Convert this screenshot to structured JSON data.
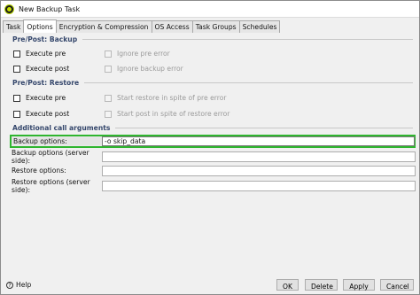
{
  "window": {
    "title": "New Backup Task"
  },
  "tabs": [
    {
      "label": "Task"
    },
    {
      "label": "Options"
    },
    {
      "label": "Encryption & Compression"
    },
    {
      "label": "OS Access"
    },
    {
      "label": "Task Groups"
    },
    {
      "label": "Schedules"
    }
  ],
  "active_tab": "Options",
  "pre_post_backup": {
    "header": "Pre/Post: Backup",
    "execute_pre": {
      "label": "Execute pre",
      "checked": false
    },
    "execute_post": {
      "label": "Execute post",
      "checked": false
    },
    "ignore_pre_error": {
      "label": "Ignore pre error",
      "checked": false,
      "enabled": false
    },
    "ignore_backup_error": {
      "label": "Ignore backup error",
      "checked": false,
      "enabled": false
    }
  },
  "pre_post_restore": {
    "header": "Pre/Post: Restore",
    "execute_pre": {
      "label": "Execute pre",
      "checked": false
    },
    "execute_post": {
      "label": "Execute post",
      "checked": false
    },
    "start_restore_pre_error": {
      "label": "Start restore in spite of pre error",
      "checked": false,
      "enabled": false
    },
    "start_post_restore_error": {
      "label": "Start post in spite of restore error",
      "checked": false,
      "enabled": false
    }
  },
  "additional_args": {
    "header": "Additional call arguments",
    "backup_options": {
      "label": "Backup options:",
      "value": "-o skip_data"
    },
    "backup_options_server": {
      "label": "Backup options (server side):",
      "value": ""
    },
    "restore_options": {
      "label": "Restore options:",
      "value": ""
    },
    "restore_options_server": {
      "label": "Restore options (server side):",
      "value": ""
    }
  },
  "footer": {
    "help_label": "Help",
    "ok_label": "OK",
    "delete_label": "Delete",
    "apply_label": "Apply",
    "cancel_label": "Cancel"
  },
  "colors": {
    "highlight_border": "#2fb52f",
    "section_header": "#34466b"
  }
}
